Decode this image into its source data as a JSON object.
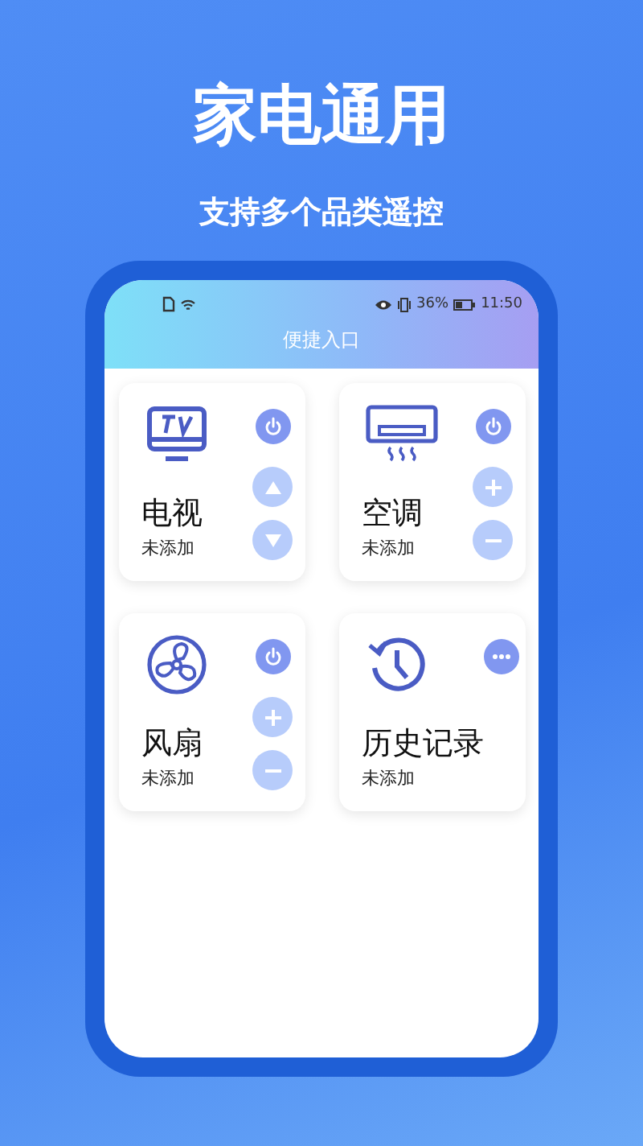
{
  "headline": "家电通用",
  "subtitle": "支持多个品类遥控",
  "status_bar": {
    "battery_percent": "36%",
    "time": "11:50"
  },
  "screen_title": "便捷入口",
  "devices": [
    {
      "kind": "tv",
      "name": "电视",
      "status": "未添加",
      "buttons": [
        {
          "kind": "power"
        },
        {
          "kind": "up"
        },
        {
          "kind": "down"
        }
      ]
    },
    {
      "kind": "ac",
      "name": "空调",
      "status": "未添加",
      "buttons": [
        {
          "kind": "power"
        },
        {
          "kind": "plus"
        },
        {
          "kind": "minus"
        }
      ]
    },
    {
      "kind": "fan",
      "name": "风扇",
      "status": "未添加",
      "buttons": [
        {
          "kind": "power"
        },
        {
          "kind": "plus"
        },
        {
          "kind": "minus"
        }
      ]
    },
    {
      "kind": "history",
      "name": "历史记录",
      "status": "未添加",
      "buttons": [
        {
          "kind": "more"
        }
      ]
    }
  ]
}
